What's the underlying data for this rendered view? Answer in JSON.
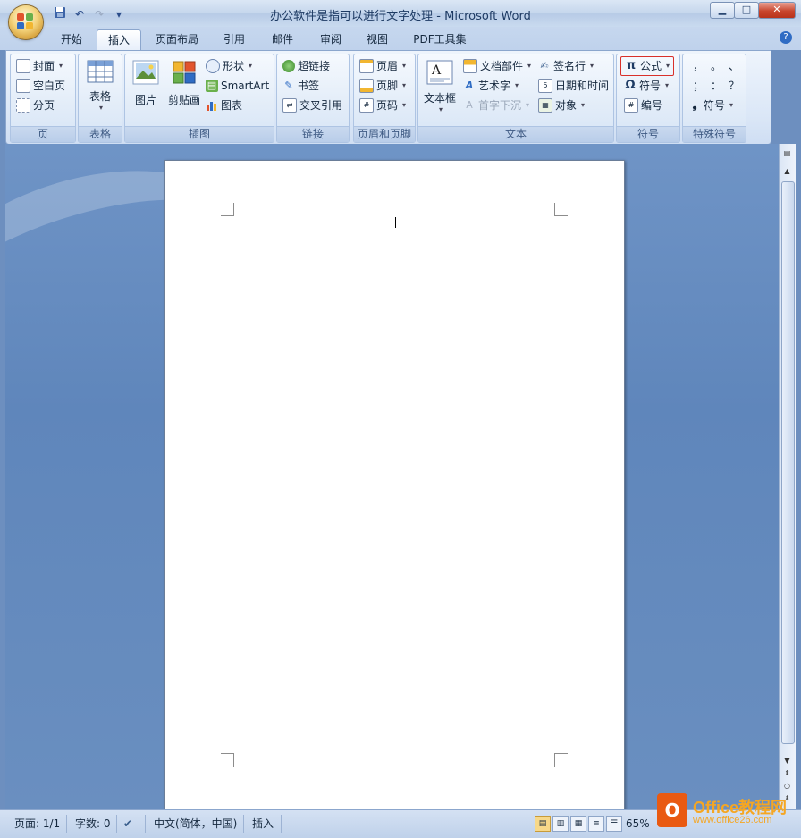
{
  "window": {
    "title": "办公软件是指可以进行文字处理 - Microsoft Word",
    "buttons": {
      "minimize": "▁",
      "maximize": "□",
      "close": "✕"
    }
  },
  "quick_access": {
    "save_icon": "save-icon",
    "undo": "↶",
    "redo": "↷",
    "more": "▾"
  },
  "tabs": [
    "开始",
    "插入",
    "页面布局",
    "引用",
    "邮件",
    "审阅",
    "视图",
    "PDF工具集"
  ],
  "active_tab": "插入",
  "ribbon": {
    "page": {
      "label": "页",
      "items": [
        "封面",
        "空白页",
        "分页"
      ]
    },
    "table": {
      "label": "表格",
      "button": "表格"
    },
    "illustrations": {
      "label": "插图",
      "picture": "图片",
      "clipart": "剪贴画",
      "shapes": "形状",
      "smartart": "SmartArt",
      "chart": "图表"
    },
    "links": {
      "label": "链接",
      "items": [
        "超链接",
        "书签",
        "交叉引用"
      ]
    },
    "header_footer": {
      "label": "页眉和页脚",
      "items": [
        "页眉",
        "页脚",
        "页码"
      ]
    },
    "text": {
      "label": "文本",
      "textbox": "文本框",
      "quick_parts": "文档部件",
      "wordart": "艺术字",
      "dropcap": "首字下沉",
      "signature": "签名行",
      "datetime": "日期和时间",
      "object": "对象"
    },
    "symbols": {
      "label": "符号",
      "equation": "公式",
      "symbol": "符号",
      "number": "编号"
    },
    "special": {
      "label": "特殊符号",
      "chars": [
        "，",
        "。",
        "、",
        "；",
        "：",
        "？"
      ],
      "symbol": "符号"
    }
  },
  "status": {
    "page": "页面: 1/1",
    "words": "字数: 0",
    "language": "中文(简体，中国)",
    "mode": "插入",
    "zoom": "65%"
  },
  "watermark": {
    "line1": "Office教程网",
    "line2": "www.office26.com"
  },
  "colors": {
    "accent_highlight": "#d9302a",
    "ribbon_bg": "#dbe7f7",
    "workspace_bg": "#6a8fc0"
  }
}
